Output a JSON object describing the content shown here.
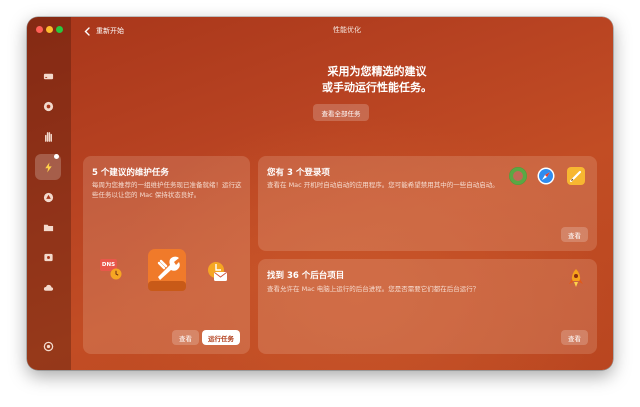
{
  "window": {
    "title": "性能优化",
    "back_label": "重新开始"
  },
  "sidebar": {
    "items": [
      {
        "icon": "disk-icon"
      },
      {
        "icon": "shield-icon"
      },
      {
        "icon": "hand-icon"
      },
      {
        "icon": "lightning-icon",
        "active": true
      },
      {
        "icon": "apps-icon"
      },
      {
        "icon": "folder-icon"
      },
      {
        "icon": "lock-icon"
      },
      {
        "icon": "cloud-icon"
      },
      {
        "icon": "account-icon"
      }
    ]
  },
  "hero": {
    "line1": "采用为您精选的建议",
    "line2": "或手动运行性能任务。",
    "view_all_label": "查看全部任务"
  },
  "maintenance_card": {
    "title": "5 个建议的维护任务",
    "description": "每周为您推荐的一组维护任务现已准备就绪！运行这些任务以让您的 Mac 保持状态良好。",
    "dns_label": "DNS",
    "view_label": "查看",
    "run_label": "运行任务"
  },
  "login_card": {
    "title": "您有 3 个登录项",
    "description": "查看在 Mac 开机时自动启动的应用程序。您可能希望禁用其中的一些自动启动。",
    "view_label": "查看"
  },
  "background_card": {
    "title": "找到 36 个后台项目",
    "description": "查看允许在 Mac 电脑上运行的后台进程。您是否需要它们都在后台运行？",
    "view_label": "查看"
  },
  "colors": {
    "accent": "#b3411f",
    "window_bg": "#b84322"
  }
}
